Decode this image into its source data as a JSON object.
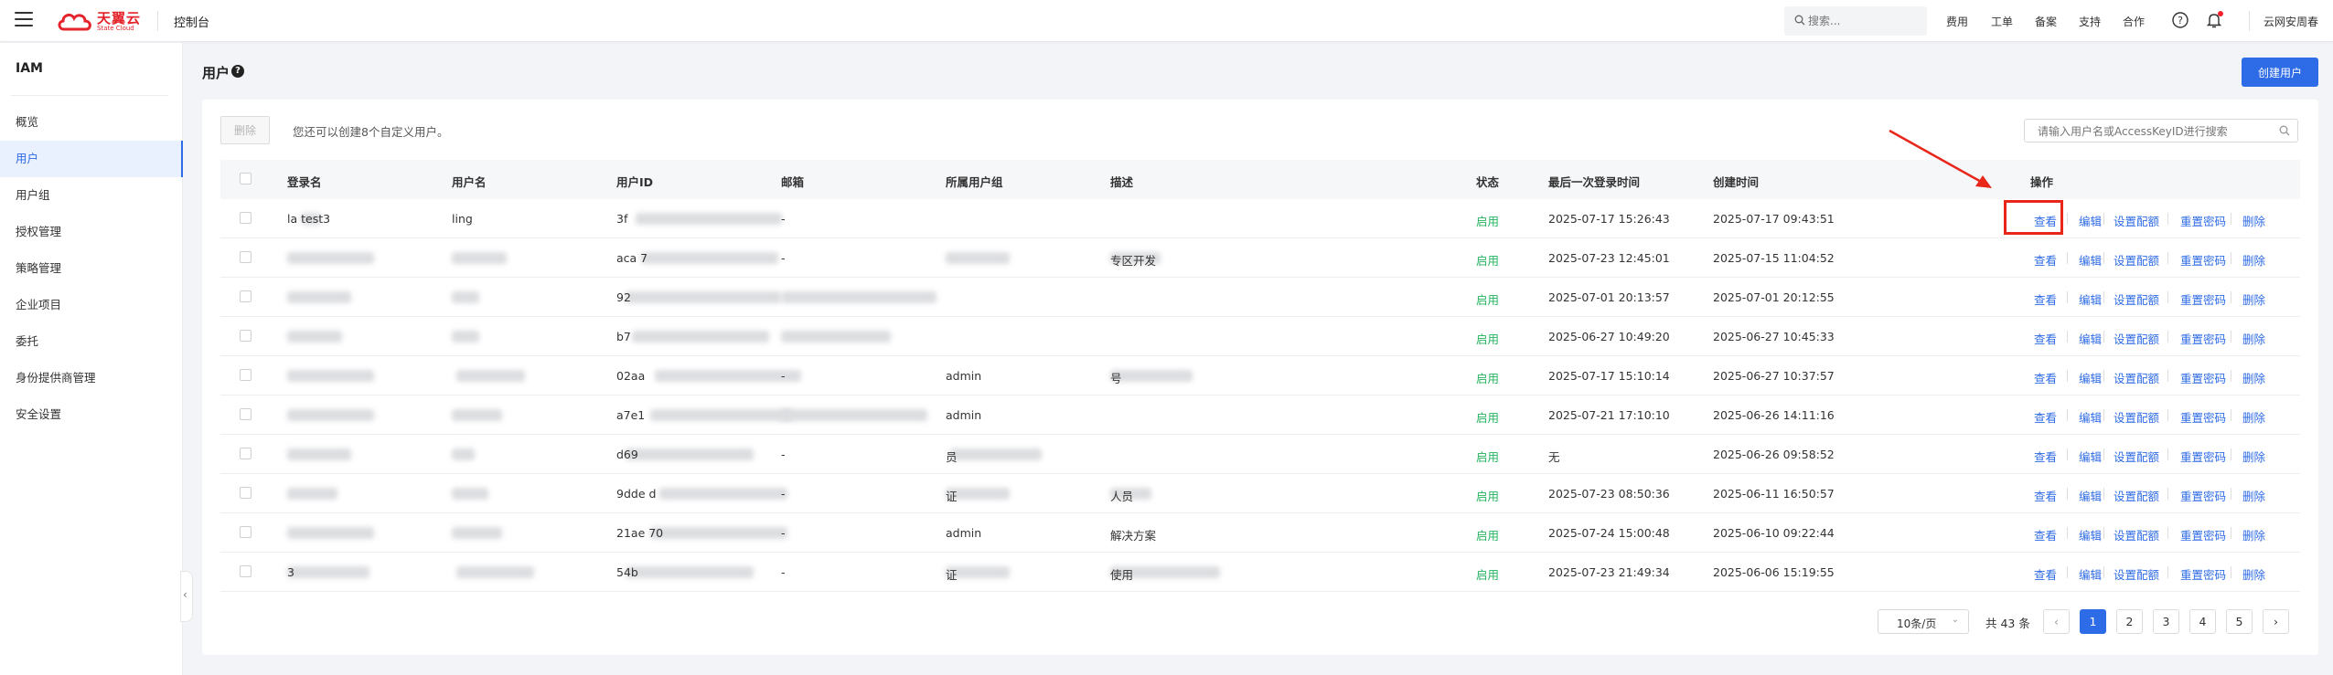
{
  "topbar": {
    "brand_cn": "天翼云",
    "brand_en": "State Cloud",
    "console": "控制台",
    "search_placeholder": "搜索...",
    "links": [
      "费用",
      "工单",
      "备案",
      "支持",
      "合作"
    ],
    "user": "云网安周春"
  },
  "sidebar": {
    "title": "IAM",
    "items": [
      "概览",
      "用户",
      "用户组",
      "授权管理",
      "策略管理",
      "企业项目",
      "委托",
      "身份提供商管理",
      "安全设置"
    ],
    "active": "用户"
  },
  "page": {
    "title": "用户",
    "create_button": "创建用户"
  },
  "toolbar": {
    "delete_button": "删除",
    "hint": "您还可以创建8个自定义用户。",
    "search_placeholder": "请输入用户名或AccessKeyID进行搜索"
  },
  "table": {
    "headers": [
      "登录名",
      "用户名",
      "用户ID",
      "邮箱",
      "所属用户组",
      "描述",
      "状态",
      "最后一次登录时间",
      "创建时间",
      "操作"
    ],
    "actions": [
      "查看",
      "编辑",
      "设置配额",
      "重置密码",
      "删除"
    ],
    "rows": [
      {
        "login": "la test3",
        "username": "ling",
        "userid": "3f",
        "email": "-",
        "group": "",
        "desc": "",
        "status": "启用",
        "last_login": "2025-07-17 15:26:43",
        "created": "2025-07-17 09:43:51"
      },
      {
        "login": "",
        "username": "",
        "userid": "aca 7",
        "email": "-",
        "group": "",
        "desc": "专区开发",
        "status": "启用",
        "last_login": "2025-07-23 12:45:01",
        "created": "2025-07-15 11:04:52"
      },
      {
        "login": "",
        "username": "",
        "userid": "92",
        "email": "",
        "group": "",
        "desc": "",
        "status": "启用",
        "last_login": "2025-07-01 20:13:57",
        "created": "2025-07-01 20:12:55"
      },
      {
        "login": "",
        "username": "",
        "userid": "b7",
        "email": "",
        "group": "",
        "desc": "",
        "status": "启用",
        "last_login": "2025-06-27 10:49:20",
        "created": "2025-06-27 10:45:33"
      },
      {
        "login": "",
        "username": "",
        "userid": "02aa",
        "email": "-",
        "group": "admin",
        "desc": "号",
        "status": "启用",
        "last_login": "2025-07-17 15:10:14",
        "created": "2025-06-27 10:37:57"
      },
      {
        "login": "",
        "username": "",
        "userid": "a7e1",
        "email": "",
        "group": "admin",
        "desc": "",
        "status": "启用",
        "last_login": "2025-07-21 17:10:10",
        "created": "2025-06-26 14:11:16"
      },
      {
        "login": "",
        "username": "",
        "userid": "d69",
        "email": "-",
        "group": "员",
        "desc": "",
        "status": "启用",
        "last_login": "无",
        "created": "2025-06-26 09:58:52"
      },
      {
        "login": "",
        "username": "",
        "userid": "9dde d",
        "email": "-",
        "group": "证",
        "desc": "人员",
        "status": "启用",
        "last_login": "2025-07-23 08:50:36",
        "created": "2025-06-11 16:50:57"
      },
      {
        "login": "",
        "username": "",
        "userid": "21ae 70",
        "email": "-",
        "group": "admin",
        "desc": "解决方案",
        "status": "启用",
        "last_login": "2025-07-24 15:00:48",
        "created": "2025-06-10 09:22:44"
      },
      {
        "login": "3",
        "username": "",
        "userid": "54b",
        "email": "-",
        "group": "证",
        "desc": "使用",
        "status": "启用",
        "last_login": "2025-07-23 21:49:34",
        "created": "2025-06-06 15:19:55"
      }
    ]
  },
  "pagination": {
    "page_size": "10条/页",
    "total": "共 43 条",
    "pages": [
      "1",
      "2",
      "3",
      "4",
      "5"
    ],
    "current": "1"
  },
  "colors": {
    "accent": "#2e6be6",
    "status_green": "#22b35e",
    "annotation_red": "#e8261a"
  }
}
